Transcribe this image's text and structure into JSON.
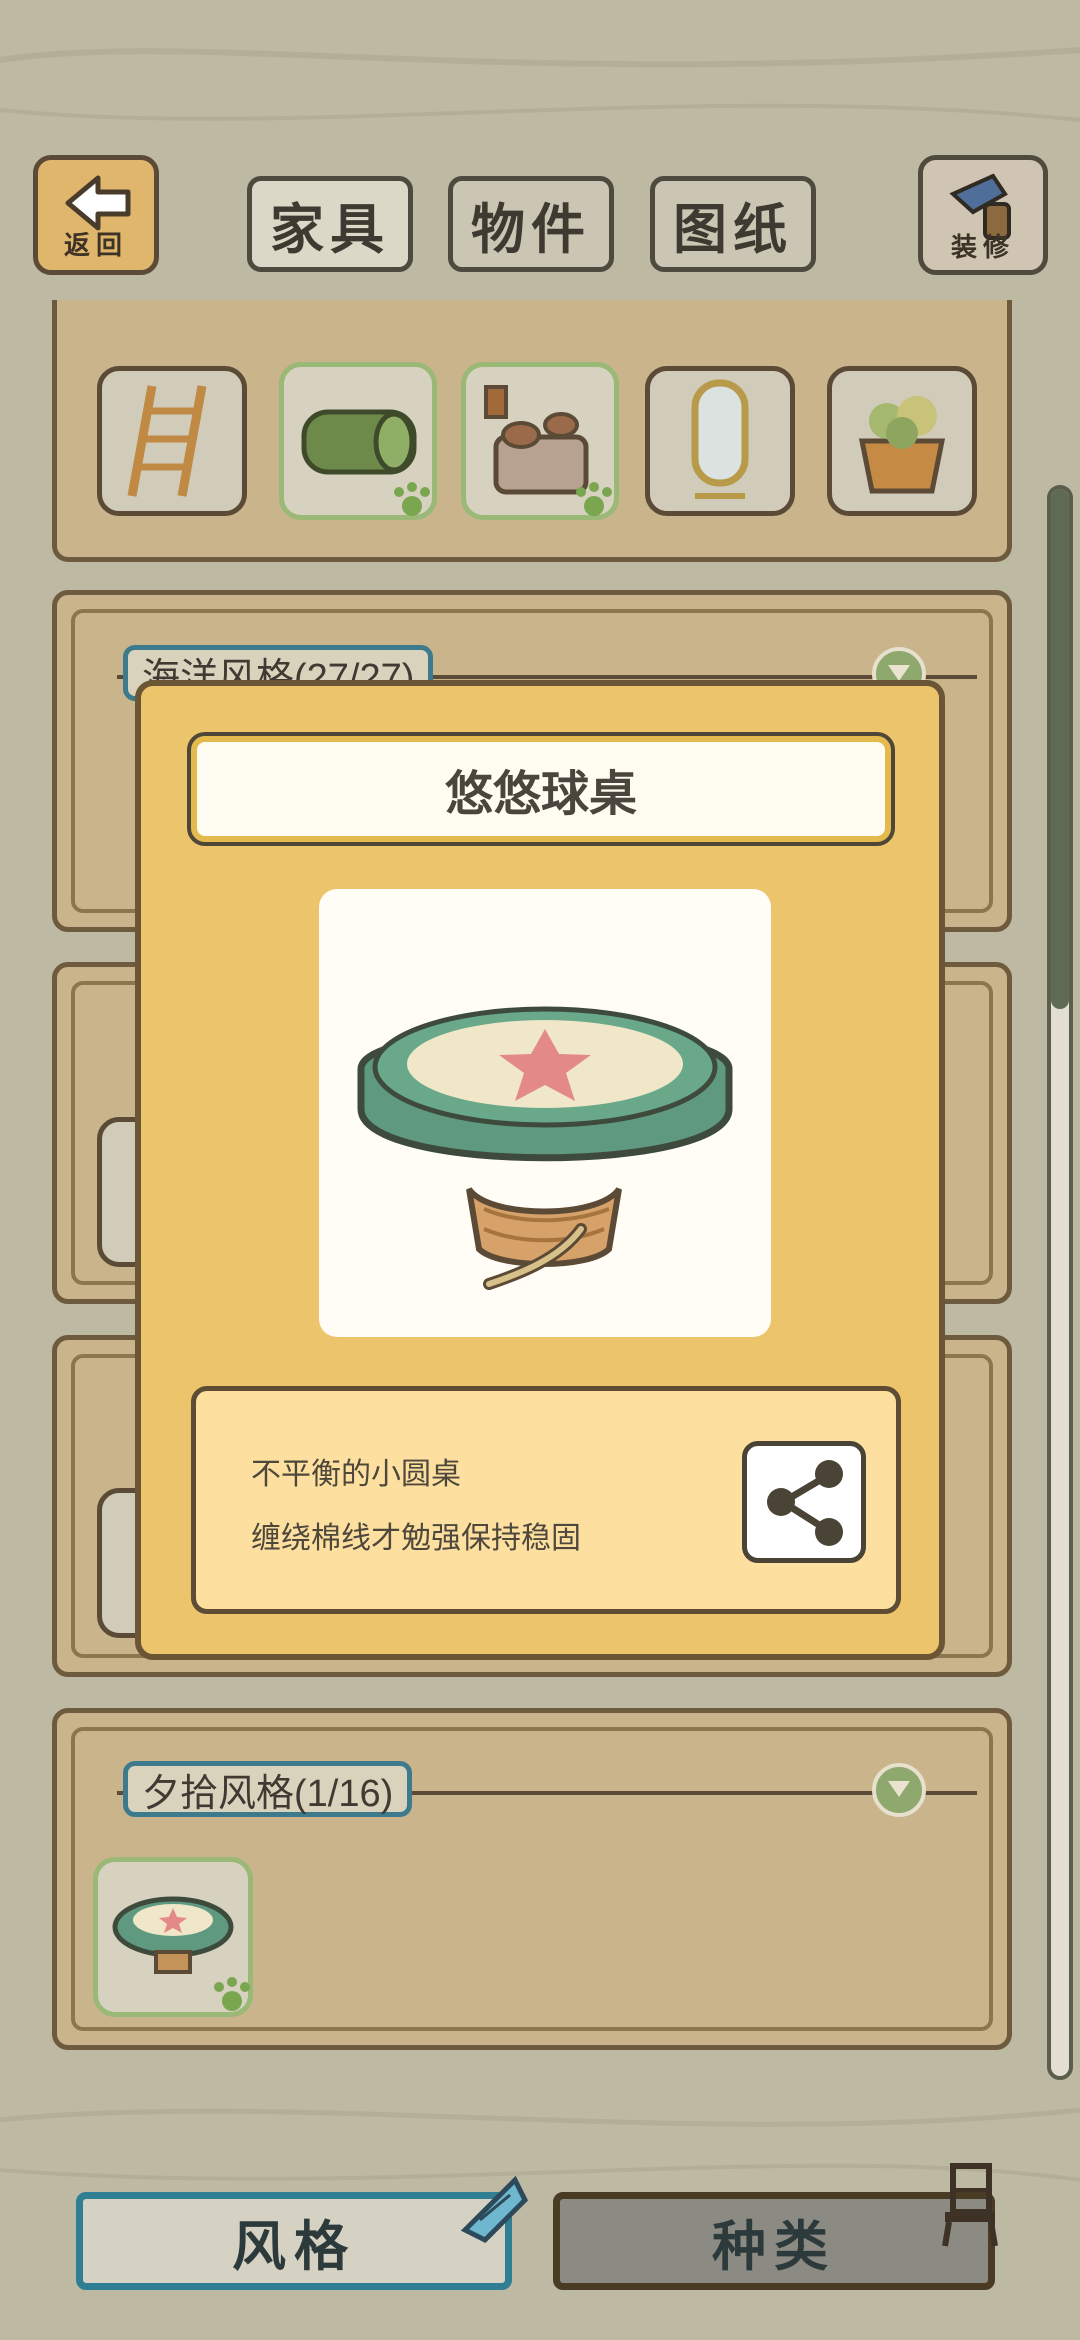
{
  "header": {
    "back_label": "返回",
    "decorate_label": "装修",
    "tabs": [
      {
        "label": "家具",
        "active": true
      },
      {
        "label": "物件",
        "active": false
      },
      {
        "label": "图纸",
        "active": false
      }
    ]
  },
  "sections": [
    {
      "title": "海洋风格(27/27)"
    },
    {
      "title": "夕拾风格(1/16)"
    }
  ],
  "popup": {
    "item_name": "悠悠球桌",
    "description_line1": "不平衡的小圆桌",
    "description_line2": "缠绕棉线才勉强保持稳固"
  },
  "bottom_nav": {
    "style_label": "风格",
    "category_label": "种类"
  },
  "colors": {
    "background": "#bdb9a3",
    "popup": "#ecc46c",
    "accent_teal": "#3d7a8c",
    "owned_green": "#9ab876"
  }
}
